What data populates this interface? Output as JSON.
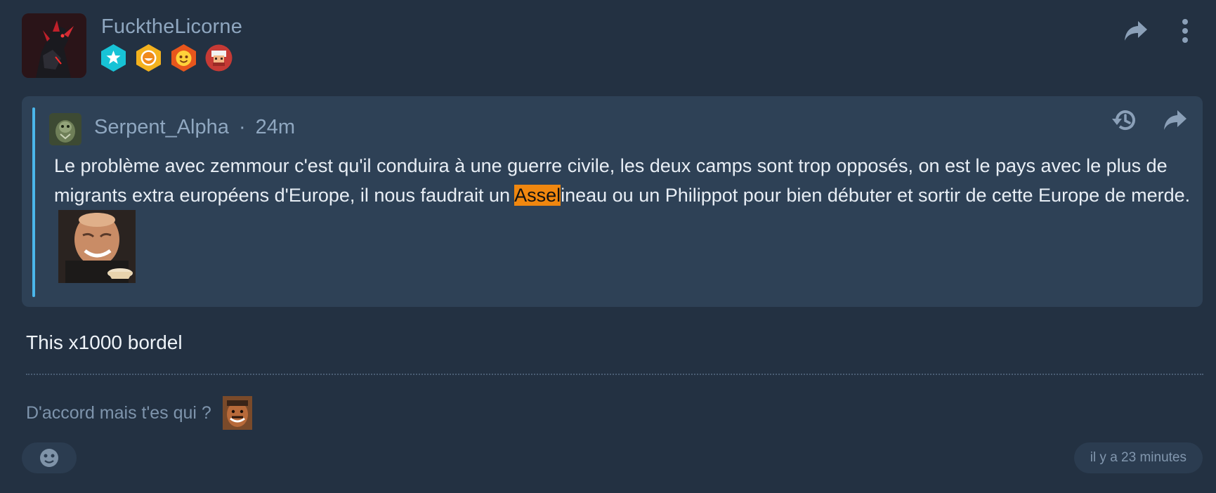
{
  "post": {
    "author": "FucktheLicorne",
    "badges": [
      "star-badge",
      "smile-badge",
      "emoji-badge",
      "pixel-face-badge"
    ],
    "quote": {
      "author": "Serpent_Alpha",
      "separator": "·",
      "age": "24m",
      "text_before": "Le problème avec zemmour c'est qu'il conduira à une guerre civile, les deux camps sont trop opposés, on est le pays avec le plus de migrants extra européens d'Europe, il nous faudrait un ",
      "highlight": "Assel",
      "text_after": "ineau ou un Philippot pour bien débuter et sortir de cette Europe de merde. "
    },
    "body": "This x1000 bordel",
    "signature": "D'accord mais t'es qui ?",
    "timestamp": "il y a 23 minutes"
  },
  "colors": {
    "background": "#233142",
    "quote_background": "#2e4156",
    "quote_bar": "#4bb6ea",
    "highlight": "#f0870f",
    "muted_text": "#8fa7c0"
  }
}
